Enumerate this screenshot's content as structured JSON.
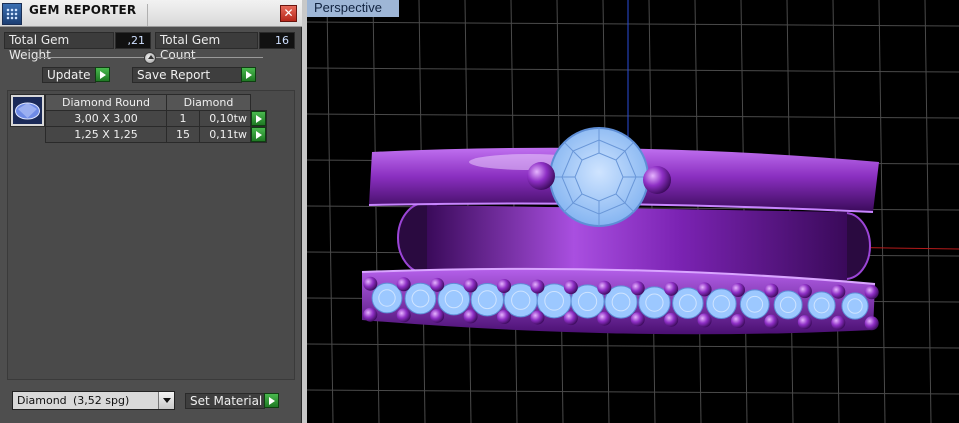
{
  "window": {
    "title": "GEM REPORTER",
    "close_glyph": "✕"
  },
  "totals": {
    "weight_label": "Total Gem Weight",
    "weight_value": ",21",
    "count_label": "Total Gem Count",
    "count_value": "16"
  },
  "buttons": {
    "update": "Update",
    "save_report": "Save Report",
    "set_material": "Set Material"
  },
  "gem_table": {
    "shape": "Diamond Round",
    "material": "Diamond",
    "rows": [
      {
        "size": "3,00 X 3,00",
        "count": "1",
        "weight": "0,10tw"
      },
      {
        "size": "1,25 X 1,25",
        "count": "15",
        "weight": "0,11tw"
      }
    ]
  },
  "material_select": {
    "name": "Diamond",
    "spg": "(3,52 spg)"
  },
  "viewport": {
    "label": "Perspective"
  },
  "icons": {
    "title": "gem-reporter-icon",
    "close": "close-icon",
    "play": "play-icon",
    "gem": "diamond-thumbnail-icon",
    "dropdown": "chevron-down-icon",
    "slider": "slider-knob-icon"
  },
  "colors": {
    "panel_bg": "#4e4e4e",
    "play_green": "#2f9a35",
    "viewport_bg": "#000000",
    "metal_purple": "#8a2fc0",
    "gem_blue": "#9cc8ff",
    "label_blue": "#9eb6d6"
  }
}
